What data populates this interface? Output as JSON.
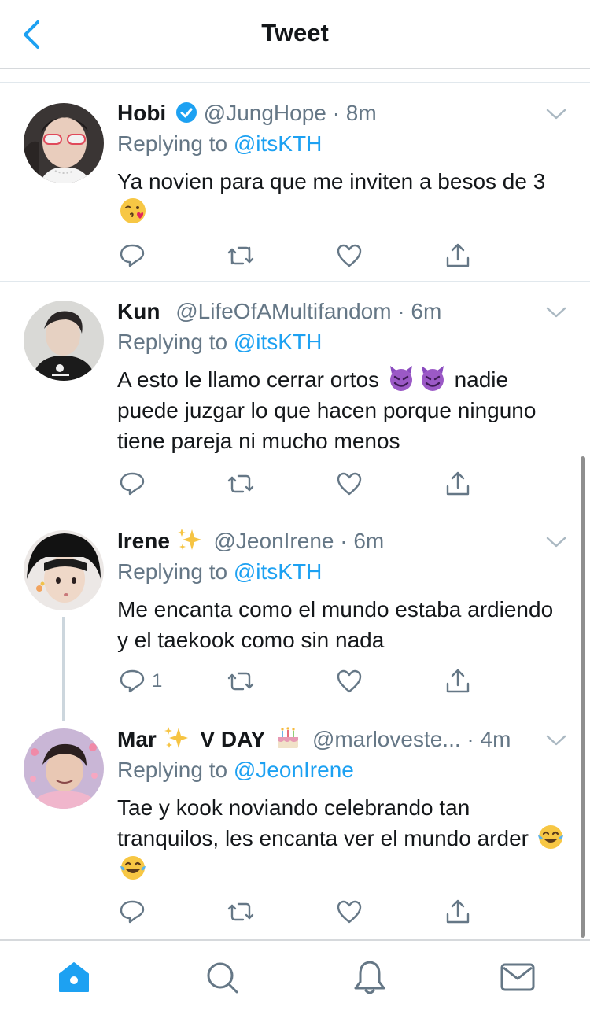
{
  "header": {
    "title": "Tweet"
  },
  "tweets": [
    {
      "name": "Hobi",
      "handle": "@JungHope",
      "time": "8m",
      "replying_prefix": "Replying to",
      "replying_to": "@itsKTH",
      "text": "Ya novien para que me inviten a besos de 3",
      "reply_count": ""
    },
    {
      "name": "Kun",
      "handle": "@LifeOfAMultifandom",
      "time": "6m",
      "replying_prefix": "Replying to",
      "replying_to": "@itsKTH",
      "text_before": "A esto le llamo cerrar ortos",
      "text_after": "nadie puede juzgar lo que hacen porque ninguno tiene pareja ni mucho menos",
      "reply_count": ""
    },
    {
      "name": "Irene",
      "handle": "@JeonIrene",
      "time": "6m",
      "replying_prefix": "Replying to",
      "replying_to": "@itsKTH",
      "text": "Me encanta como el mundo estaba ardiendo y el taekook como sin nada",
      "reply_count": "1"
    },
    {
      "name": "Mar",
      "name_suffix": "V DAY",
      "handle": "@marloveste...",
      "time": "4m",
      "replying_prefix": "Replying to",
      "replying_to": "@JeonIrene",
      "text": "Tae y kook noviando celebrando tan tranquilos, les encanta ver el mundo arder",
      "reply_count": ""
    }
  ],
  "tabbar": {
    "items": [
      "home-icon",
      "search-icon",
      "notifications-icon",
      "messages-icon"
    ]
  },
  "colors": {
    "accent": "#1da1f2",
    "secondary_text": "#657786",
    "divider": "#e1e8ed"
  }
}
